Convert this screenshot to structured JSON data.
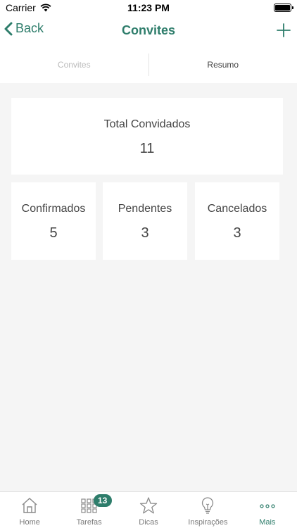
{
  "status_bar": {
    "carrier": "Carrier",
    "time": "11:23 PM"
  },
  "nav": {
    "back_label": "Back",
    "title": "Convites"
  },
  "tabs": [
    {
      "label": "Convites",
      "active": false
    },
    {
      "label": "Resumo",
      "active": true
    }
  ],
  "summary": {
    "total": {
      "label": "Total Convidados",
      "value": "11"
    },
    "confirmed": {
      "label": "Confirmados",
      "value": "5"
    },
    "pending": {
      "label": "Pendentes",
      "value": "3"
    },
    "cancelled": {
      "label": "Cancelados",
      "value": "3"
    }
  },
  "tab_bar": {
    "items": [
      {
        "label": "Home",
        "icon": "home-icon"
      },
      {
        "label": "Tarefas",
        "icon": "grid-icon",
        "badge": "13"
      },
      {
        "label": "Dicas",
        "icon": "star-icon"
      },
      {
        "label": "Inspirações",
        "icon": "lightbulb-icon"
      },
      {
        "label": "Mais",
        "icon": "more-icon",
        "active": true
      }
    ]
  },
  "colors": {
    "accent": "#2e7d6b",
    "background": "#f5f5f5"
  }
}
